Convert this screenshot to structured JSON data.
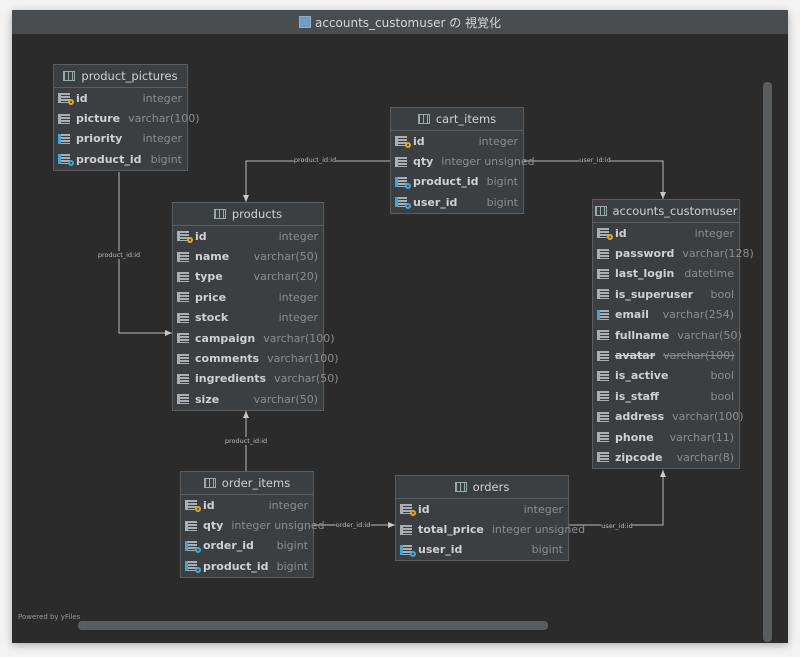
{
  "window": {
    "title": "accounts_customuser の 視覚化"
  },
  "footer": {
    "powered_by": "Powered by yFiles"
  },
  "colors": {
    "canvas": "#2b2b2b",
    "table": "#3c3f41",
    "primary_key": "#e0a828",
    "foreign_key": "#3fa7d6"
  },
  "tables": [
    {
      "name": "product_pictures",
      "columns": [
        {
          "name": "id",
          "type": "integer",
          "icon": "primary-key"
        },
        {
          "name": "picture",
          "type": "varchar(100)",
          "icon": "column"
        },
        {
          "name": "priority",
          "type": "integer",
          "icon": "not-null-column"
        },
        {
          "name": "product_id",
          "type": "bigint",
          "icon": "foreign-key"
        }
      ]
    },
    {
      "name": "cart_items",
      "columns": [
        {
          "name": "id",
          "type": "integer",
          "icon": "primary-key"
        },
        {
          "name": "qty",
          "type": "integer unsigned",
          "icon": "column"
        },
        {
          "name": "product_id",
          "type": "bigint",
          "icon": "foreign-key"
        },
        {
          "name": "user_id",
          "type": "bigint",
          "icon": "foreign-key"
        }
      ]
    },
    {
      "name": "products",
      "columns": [
        {
          "name": "id",
          "type": "integer",
          "icon": "primary-key"
        },
        {
          "name": "name",
          "type": "varchar(50)",
          "icon": "column"
        },
        {
          "name": "type",
          "type": "varchar(20)",
          "icon": "column"
        },
        {
          "name": "price",
          "type": "integer",
          "icon": "column"
        },
        {
          "name": "stock",
          "type": "integer",
          "icon": "column"
        },
        {
          "name": "campaign",
          "type": "varchar(100)",
          "icon": "column"
        },
        {
          "name": "comments",
          "type": "varchar(100)",
          "icon": "column"
        },
        {
          "name": "ingredients",
          "type": "varchar(50)",
          "icon": "column"
        },
        {
          "name": "size",
          "type": "varchar(50)",
          "icon": "column"
        }
      ]
    },
    {
      "name": "accounts_customuser",
      "columns": [
        {
          "name": "id",
          "type": "integer",
          "icon": "primary-key"
        },
        {
          "name": "password",
          "type": "varchar(128)",
          "icon": "column"
        },
        {
          "name": "last_login",
          "type": "datetime",
          "icon": "column"
        },
        {
          "name": "is_superuser",
          "type": "bool",
          "icon": "column"
        },
        {
          "name": "email",
          "type": "varchar(254)",
          "icon": "not-null-column"
        },
        {
          "name": "fullname",
          "type": "varchar(50)",
          "icon": "column"
        },
        {
          "name": "avatar",
          "type": "varchar(100)",
          "icon": "column",
          "struck": true
        },
        {
          "name": "is_active",
          "type": "bool",
          "icon": "column"
        },
        {
          "name": "is_staff",
          "type": "bool",
          "icon": "column"
        },
        {
          "name": "address",
          "type": "varchar(100)",
          "icon": "column"
        },
        {
          "name": "phone",
          "type": "varchar(11)",
          "icon": "column"
        },
        {
          "name": "zipcode",
          "type": "varchar(8)",
          "icon": "column"
        }
      ]
    },
    {
      "name": "order_items",
      "columns": [
        {
          "name": "id",
          "type": "integer",
          "icon": "primary-key"
        },
        {
          "name": "qty",
          "type": "integer unsigned",
          "icon": "column"
        },
        {
          "name": "order_id",
          "type": "bigint",
          "icon": "foreign-key"
        },
        {
          "name": "product_id",
          "type": "bigint",
          "icon": "foreign-key"
        }
      ]
    },
    {
      "name": "orders",
      "columns": [
        {
          "name": "id",
          "type": "integer",
          "icon": "primary-key"
        },
        {
          "name": "total_price",
          "type": "integer unsigned",
          "icon": "column"
        },
        {
          "name": "user_id",
          "type": "bigint",
          "icon": "foreign-key"
        }
      ]
    }
  ],
  "relations": [
    {
      "from": "cart_items",
      "to": "products",
      "label": "product_id:id"
    },
    {
      "from": "cart_items",
      "to": "accounts_customuser",
      "label": "user_id:id"
    },
    {
      "from": "product_pictures",
      "to": "products",
      "label": "product_id:id"
    },
    {
      "from": "order_items",
      "to": "products",
      "label": "product_id:id"
    },
    {
      "from": "order_items",
      "to": "orders",
      "label": "order_id:id"
    },
    {
      "from": "orders",
      "to": "accounts_customuser",
      "label": "user_id:id"
    }
  ]
}
